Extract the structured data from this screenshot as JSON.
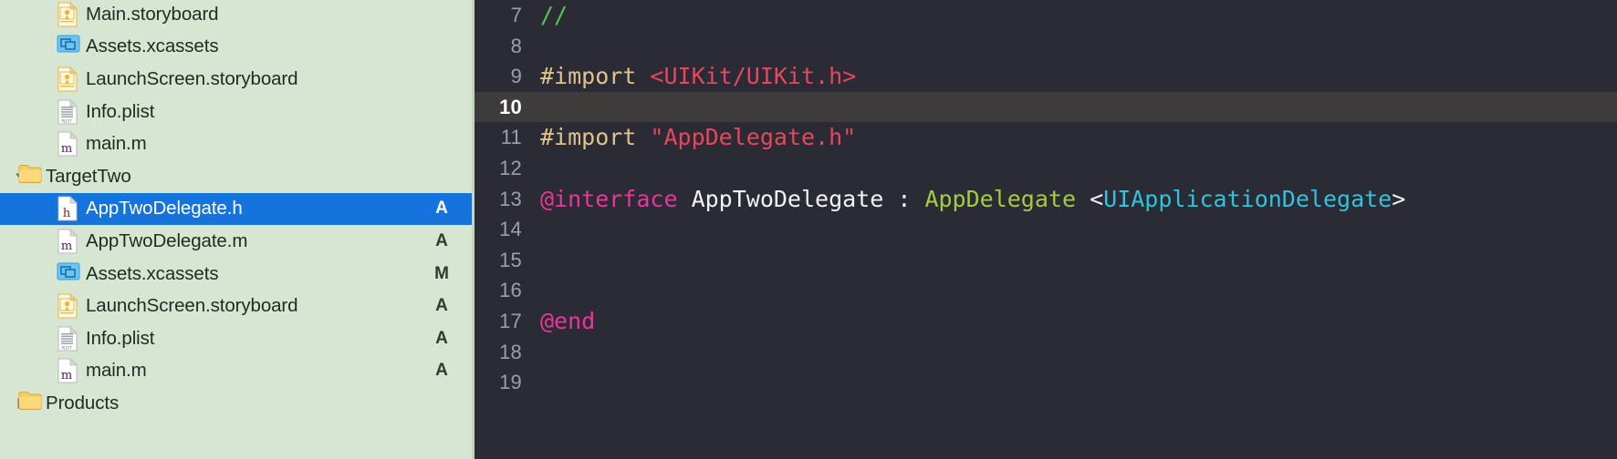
{
  "sidebar": {
    "background_color": "#d6e6d3",
    "selection_color": "#1473dc",
    "rows": [
      {
        "label": "Main.storyboard",
        "icon": "storyboard-file-icon",
        "status": "",
        "level": 2,
        "disclosure": "",
        "selected": false
      },
      {
        "label": "Assets.xcassets",
        "icon": "xcassets-icon",
        "status": "",
        "level": 2,
        "disclosure": "",
        "selected": false
      },
      {
        "label": "LaunchScreen.storyboard",
        "icon": "storyboard-file-icon",
        "status": "",
        "level": 2,
        "disclosure": "",
        "selected": false
      },
      {
        "label": "Info.plist",
        "icon": "plist-file-icon",
        "status": "",
        "level": 2,
        "disclosure": "",
        "selected": false
      },
      {
        "label": "main.m",
        "icon": "m-file-icon",
        "status": "",
        "level": 2,
        "disclosure": "",
        "selected": false
      },
      {
        "label": "TargetTwo",
        "icon": "folder-icon",
        "status": "",
        "level": 1,
        "disclosure": "expanded",
        "selected": false
      },
      {
        "label": "AppTwoDelegate.h",
        "icon": "h-file-icon",
        "status": "A",
        "level": 2,
        "disclosure": "",
        "selected": true
      },
      {
        "label": "AppTwoDelegate.m",
        "icon": "m-file-icon",
        "status": "A",
        "level": 2,
        "disclosure": "",
        "selected": false
      },
      {
        "label": "Assets.xcassets",
        "icon": "xcassets-icon",
        "status": "M",
        "level": 2,
        "disclosure": "",
        "selected": false
      },
      {
        "label": "LaunchScreen.storyboard",
        "icon": "storyboard-file-icon",
        "status": "A",
        "level": 2,
        "disclosure": "",
        "selected": false
      },
      {
        "label": "Info.plist",
        "icon": "plist-file-icon",
        "status": "A",
        "level": 2,
        "disclosure": "",
        "selected": false
      },
      {
        "label": "main.m",
        "icon": "m-file-icon",
        "status": "A",
        "level": 2,
        "disclosure": "",
        "selected": false
      },
      {
        "label": "Products",
        "icon": "folder-icon",
        "status": "",
        "level": 1,
        "disclosure": "collapsed",
        "selected": false
      }
    ]
  },
  "editor": {
    "background_color": "#2b2b35",
    "current_line_color": "#3d3c3a",
    "current_line": "10",
    "lines": [
      {
        "number": "7",
        "current": false,
        "tokens": [
          {
            "text": "//",
            "type": "comment"
          }
        ]
      },
      {
        "number": "8",
        "current": false,
        "tokens": []
      },
      {
        "number": "9",
        "current": false,
        "tokens": [
          {
            "text": "#import",
            "type": "pre"
          },
          {
            "text": " ",
            "type": "plain"
          },
          {
            "text": "<UIKit/UIKit.h>",
            "type": "string"
          }
        ]
      },
      {
        "number": "10",
        "current": true,
        "tokens": []
      },
      {
        "number": "11",
        "current": false,
        "tokens": [
          {
            "text": "#import",
            "type": "pre"
          },
          {
            "text": " ",
            "type": "plain"
          },
          {
            "text": "\"AppDelegate.h\"",
            "type": "string"
          }
        ]
      },
      {
        "number": "12",
        "current": false,
        "tokens": []
      },
      {
        "number": "13",
        "current": false,
        "tokens": [
          {
            "text": "@interface",
            "type": "keyword"
          },
          {
            "text": " AppTwoDelegate : ",
            "type": "plain"
          },
          {
            "text": "AppDelegate",
            "type": "type"
          },
          {
            "text": " <",
            "type": "plain"
          },
          {
            "text": "UIApplicationDelegate",
            "type": "protocol"
          },
          {
            "text": ">",
            "type": "plain"
          }
        ]
      },
      {
        "number": "14",
        "current": false,
        "tokens": []
      },
      {
        "number": "15",
        "current": false,
        "tokens": []
      },
      {
        "number": "16",
        "current": false,
        "tokens": []
      },
      {
        "number": "17",
        "current": false,
        "tokens": [
          {
            "text": "@end",
            "type": "keyword"
          }
        ]
      },
      {
        "number": "18",
        "current": false,
        "tokens": []
      },
      {
        "number": "19",
        "current": false,
        "tokens": []
      }
    ]
  }
}
